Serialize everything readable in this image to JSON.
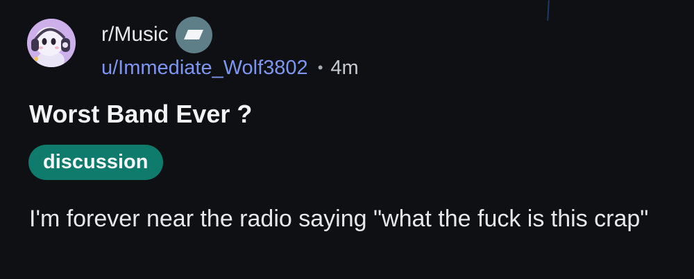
{
  "post": {
    "subreddit": "r/Music",
    "author": "u/Immediate_Wolf3802",
    "separator": "•",
    "age": "4m",
    "title": "Worst Band Ever ?",
    "flair": "discussion",
    "body": "I'm forever near the radio saying \"what the fuck is this crap\""
  },
  "icons": {
    "avatar": "music-mascot-avatar-icon",
    "badge": "mod-shield-icon"
  },
  "colors": {
    "background": "#0e1013",
    "username": "#7d96f2",
    "flair_bg": "#0f7b6c",
    "badge_bg": "#5f7f88"
  }
}
